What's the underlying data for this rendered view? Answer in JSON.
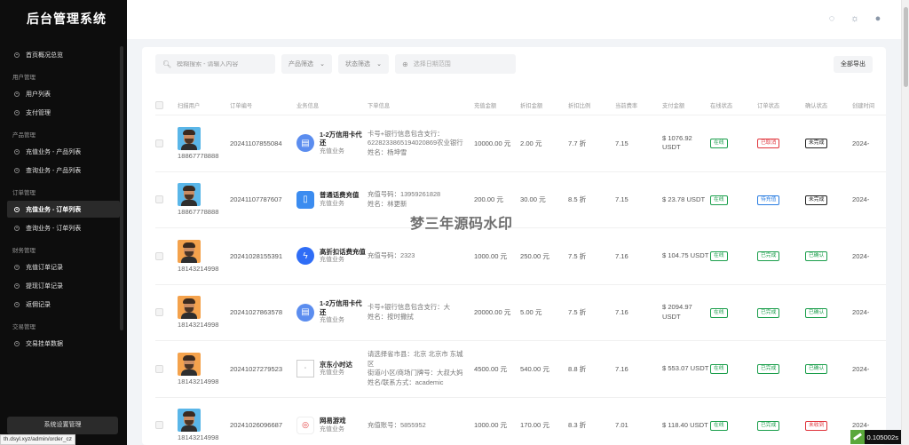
{
  "app": {
    "title": "后台管理系统"
  },
  "sidebar": {
    "first": "首页概况总览",
    "groups": [
      {
        "title": "用户管理",
        "items": [
          "用户列表",
          "支付管理"
        ]
      },
      {
        "title": "产品管理",
        "items": [
          "充值业务 - 产品列表",
          "查询业务 - 产品列表"
        ]
      },
      {
        "title": "订单管理",
        "items": [
          "充值业务 - 订单列表",
          "查询业务 - 订单列表"
        ]
      },
      {
        "title": "财务管理",
        "items": [
          "充值订单记录",
          "提现订单记录",
          "返佣记录"
        ]
      },
      {
        "title": "交易管理",
        "items": [
          "交易挂单数据"
        ]
      }
    ],
    "active": "充值业务 - 订单列表",
    "system_button": "系统设置管理"
  },
  "filters": {
    "search_placeholder": "模糊搜索 - 请输入内容",
    "product_filter": "产品筛选",
    "status_filter": "状态筛选",
    "date_placeholder": "选择日期范围",
    "export": "全部导出"
  },
  "table": {
    "headers": [
      "扫描用户",
      "订单编号",
      "业务信息",
      "下单信息",
      "充值金额",
      "折扣金额",
      "折扣比例",
      "当前费率",
      "支付金额",
      "在线状态",
      "订单状态",
      "确认状态",
      "创建时间"
    ],
    "rows": [
      {
        "user": "18867778888",
        "avatar_color": "blue",
        "order_no": "20241107855084",
        "biz_icon": "card",
        "biz_name": "1-2万信用卡代还",
        "biz_type": "充值业务",
        "info": [
          "卡号+银行信息包含支行：",
          "6228233865194020869农业银行",
          "姓名：杨坤雪"
        ],
        "amount": "10000.00 元",
        "discount": "2.00 元",
        "ratio": "7.7 折",
        "rate": "7.15",
        "pay": "$ 1076.92 USDT",
        "online": "在线",
        "online_color": "green",
        "order_status": "已取消",
        "order_color": "red",
        "confirm": "未完成",
        "confirm_color": "black",
        "time": "2024-"
      },
      {
        "user": "18867778888",
        "avatar_color": "blue",
        "order_no": "20241107787607",
        "biz_icon": "phone",
        "biz_name": "普通话费充值",
        "biz_type": "充值业务",
        "info": [
          "充值号码：13959261828",
          "姓名：林更新"
        ],
        "amount": "200.00 元",
        "discount": "30.00 元",
        "ratio": "8.5 折",
        "rate": "7.15",
        "pay": "$ 23.78 USDT",
        "online": "在线",
        "online_color": "green",
        "order_status": "待充值",
        "order_color": "blue",
        "confirm": "未完成",
        "confirm_color": "black",
        "time": "2024-"
      },
      {
        "user": "18143214998",
        "avatar_color": "orange",
        "order_no": "20241028155391",
        "biz_icon": "bolt",
        "biz_name": "高折扣话费充值",
        "biz_type": "充值业务",
        "info": [
          "充值号码：2323"
        ],
        "amount": "1000.00 元",
        "discount": "250.00 元",
        "ratio": "7.5 折",
        "rate": "7.16",
        "pay": "$ 104.75 USDT",
        "online": "在线",
        "online_color": "green",
        "order_status": "已完成",
        "order_color": "green",
        "confirm": "已确认",
        "confirm_color": "green",
        "time": "2024-"
      },
      {
        "user": "18143214998",
        "avatar_color": "orange",
        "order_no": "20241027863578",
        "biz_icon": "card",
        "biz_name": "1-2万信用卡代还",
        "biz_type": "充值业务",
        "info": [
          "卡号+银行信息包含支行：大",
          "姓名：按时撒拭"
        ],
        "amount": "20000.00 元",
        "discount": "5.00 元",
        "ratio": "7.5 折",
        "rate": "7.16",
        "pay": "$ 2094.97 USDT",
        "online": "在线",
        "online_color": "green",
        "order_status": "已完成",
        "order_color": "green",
        "confirm": "已确认",
        "confirm_color": "green",
        "time": "2024-"
      },
      {
        "user": "18143214998",
        "avatar_color": "orange",
        "order_no": "20241027279523",
        "biz_icon": "img",
        "biz_name": "京东小时达",
        "biz_type": "充值业务",
        "info": [
          "请选择省市县：北京 北京市 东城区",
          "街道/小区/商场门牌号：大叔大妈",
          "姓名/联系方式：academic"
        ],
        "amount": "4500.00 元",
        "discount": "540.00 元",
        "ratio": "8.8 折",
        "rate": "7.16",
        "pay": "$ 553.07 USDT",
        "online": "在线",
        "online_color": "green",
        "order_status": "已完成",
        "order_color": "green",
        "confirm": "已确认",
        "confirm_color": "green",
        "time": "2024-"
      },
      {
        "user": "18143214998",
        "avatar_color": "blue",
        "order_no": "20241026096687",
        "biz_icon": "game",
        "biz_name": "网易游戏",
        "biz_type": "充值业务",
        "info": [
          "充值账号：5855952"
        ],
        "amount": "1000.00 元",
        "discount": "170.00 元",
        "ratio": "8.3 折",
        "rate": "7.01",
        "pay": "$ 118.40 USDT",
        "online": "在线",
        "online_color": "green",
        "order_status": "已完成",
        "order_color": "green",
        "confirm": "未收到",
        "confirm_color": "red",
        "time": "2024-"
      }
    ]
  },
  "watermark": "梦三年源码水印",
  "statusbar": {
    "url": "th.dsyl.xyz/admin/order_cz",
    "timer": "0.105002s"
  }
}
